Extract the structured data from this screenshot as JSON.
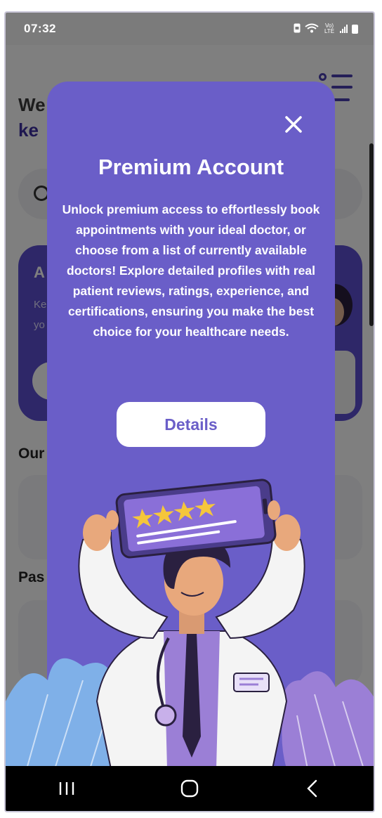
{
  "status_bar": {
    "time": "07:32",
    "network_label": "Vo) LTE"
  },
  "background": {
    "welcome_partial": "We",
    "name_partial": "ke",
    "banner_title_partial": "A",
    "banner_text_partial": "Ke m yo",
    "section1_partial": "Our",
    "section2_partial": "Pas"
  },
  "modal": {
    "title": "Premium Account",
    "body": "Unlock premium access to effortlessly book appointments with your ideal doctor, or choose from a list of currently available doctors! Explore detailed profiles with real patient reviews, ratings, experience, and certifications, ensuring you make the best choice for your healthcare needs.",
    "details_button": "Details",
    "rating_stars": 4,
    "icons": {
      "close": "close-icon"
    }
  },
  "colors": {
    "modal_bg": "#6a5ec8",
    "accent": "#3d2fa0",
    "star": "#f5c63b"
  },
  "navbar": {
    "recent": "recent-apps-icon",
    "home": "home-icon",
    "back": "back-icon"
  }
}
